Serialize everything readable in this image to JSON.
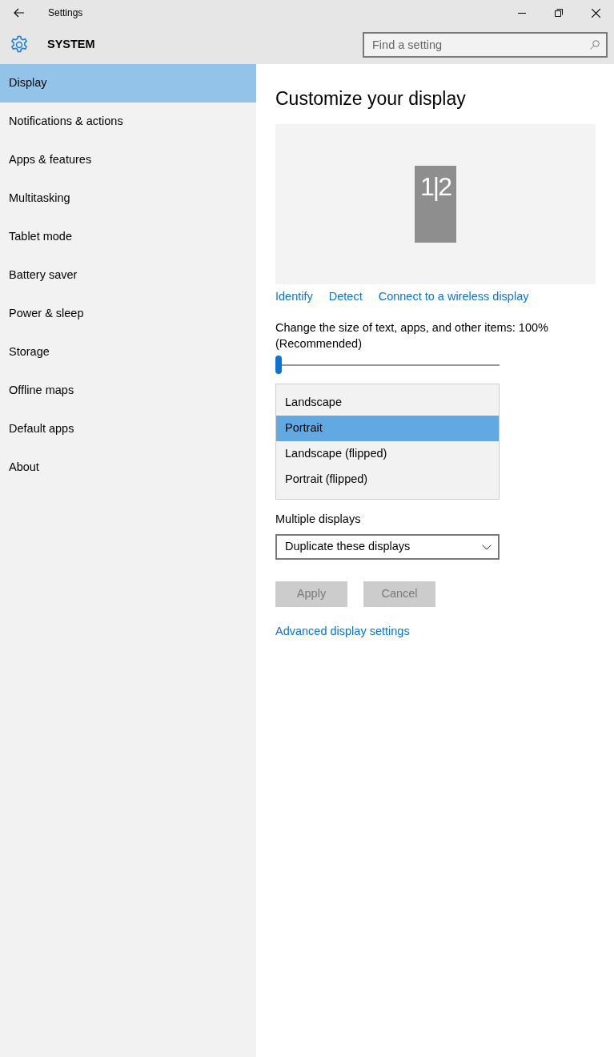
{
  "window": {
    "title": "Settings"
  },
  "header": {
    "title": "SYSTEM",
    "search": {
      "placeholder": "Find a setting"
    }
  },
  "sidebar": {
    "items": [
      {
        "label": "Display",
        "selected": true
      },
      {
        "label": "Notifications & actions",
        "selected": false
      },
      {
        "label": "Apps & features",
        "selected": false
      },
      {
        "label": "Multitasking",
        "selected": false
      },
      {
        "label": "Tablet mode",
        "selected": false
      },
      {
        "label": "Battery saver",
        "selected": false
      },
      {
        "label": "Power & sleep",
        "selected": false
      },
      {
        "label": "Storage",
        "selected": false
      },
      {
        "label": "Offline maps",
        "selected": false
      },
      {
        "label": "Default apps",
        "selected": false
      },
      {
        "label": "About",
        "selected": false
      }
    ]
  },
  "content": {
    "heading": "Customize your display",
    "monitor_label": "1|2",
    "links": [
      "Identify",
      "Detect",
      "Connect to a wireless display"
    ],
    "scale": {
      "label": "Change the size of text, apps, and other items: 100% (Recommended)",
      "level": 0
    },
    "orientation_options": [
      {
        "label": "Landscape",
        "selected": false
      },
      {
        "label": "Portrait",
        "selected": true
      },
      {
        "label": "Landscape (flipped)",
        "selected": false
      },
      {
        "label": "Portrait (flipped)",
        "selected": false
      }
    ],
    "multiple_displays": {
      "label": "Multiple displays",
      "value": "Duplicate these displays"
    },
    "buttons": [
      {
        "label": "Apply",
        "disabled": true
      },
      {
        "label": "Cancel",
        "disabled": true
      }
    ],
    "advanced_link": "Advanced display settings"
  }
}
